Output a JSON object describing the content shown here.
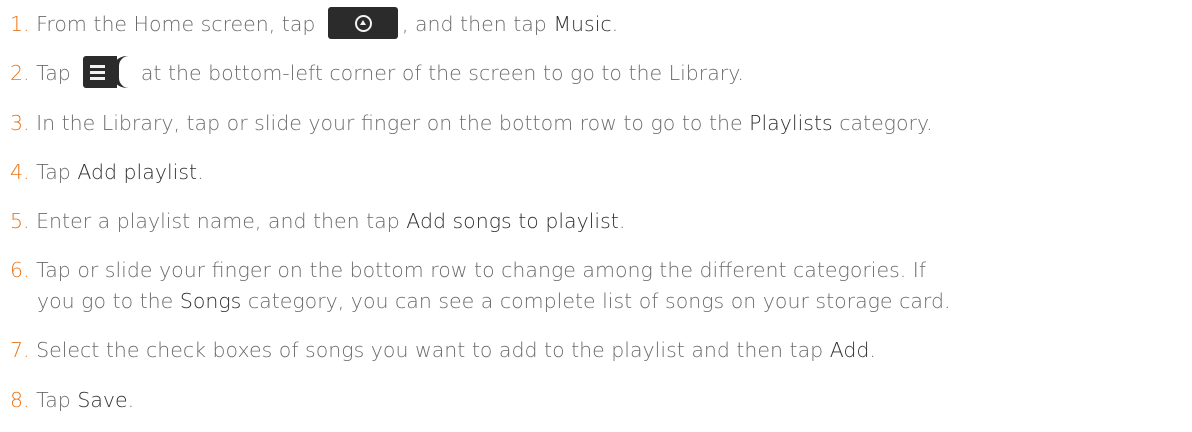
{
  "steps": [
    {
      "num": "1.",
      "a": "From the Home screen, tap",
      "b": ", and then tap",
      "c": "Music",
      "d": "."
    },
    {
      "num": "2.",
      "a": "Tap",
      "b": "at the bottom-left corner of the screen to go to the Library."
    },
    {
      "num": "3.",
      "a": "In the Library, tap or slide your finger on the bottom row to go to the",
      "b": "Playlists",
      "c": "category."
    },
    {
      "num": "4.",
      "a": "Tap",
      "b": "Add playlist",
      "c": "."
    },
    {
      "num": "5.",
      "a": "Enter a playlist name, and then tap",
      "b": "Add songs to playlist",
      "c": "."
    },
    {
      "num": "6.",
      "a": "Tap or slide your finger on the bottom row to change among the different categories. If",
      "b": "you go to the",
      "c": "Songs",
      "d": "category, you can see a complete list of songs on your storage card."
    },
    {
      "num": "7.",
      "a": "Select the check boxes of songs you want to add to the playlist and then tap",
      "b": "Add",
      "c": "."
    },
    {
      "num": "8.",
      "a": "Tap",
      "b": "Save",
      "c": "."
    }
  ],
  "icons": {
    "step1": "all-apps-button-icon",
    "step2": "library-tab-icon"
  },
  "colors": {
    "step_number": "#e8761c",
    "body_text": "#6b6b6b",
    "highlight_text": "#2f2f2f"
  }
}
